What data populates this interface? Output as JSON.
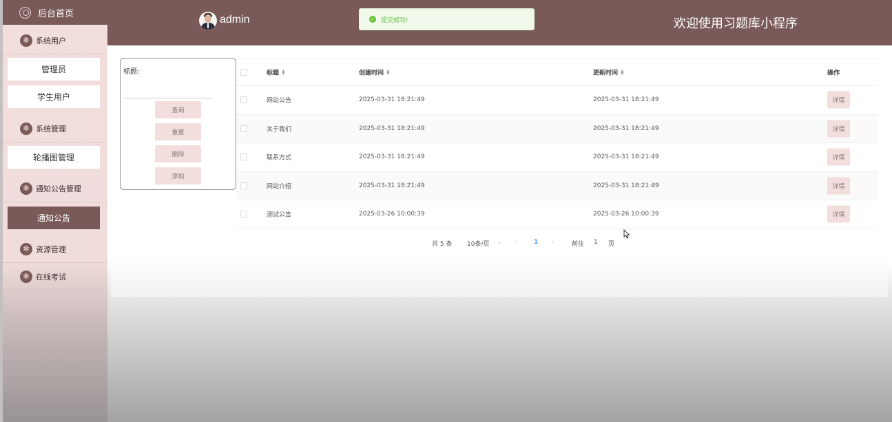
{
  "sidebar": {
    "home_label": "后台首页",
    "groups": {
      "system_users": "系统用户",
      "system_manage": "系统管理",
      "notice_manage": "通知公告管理",
      "resource_manage": "资源管理",
      "online_exam": "在线考试"
    },
    "items": {
      "admin": "管理员",
      "student": "学生用户",
      "carousel": "轮播图管理",
      "notice": "通知公告"
    },
    "active_item": "通知公告"
  },
  "header": {
    "username": "admin",
    "title": "欢迎使用习题库小程序"
  },
  "toast": {
    "message": "提交成功!",
    "icon": "check-circle-icon"
  },
  "search": {
    "label": "标题:",
    "placeholder": "",
    "buttons": {
      "query": "查询",
      "reset": "重置",
      "delete": "删除",
      "add": "添加"
    }
  },
  "table": {
    "columns": {
      "title": "标题",
      "created": "创建时间",
      "updated": "更新时间",
      "ops": "操作"
    },
    "rows": [
      {
        "title": "网站公告",
        "created": "2025-03-31 18:21:49",
        "updated": "2025-03-31 18:21:49",
        "action": "详情"
      },
      {
        "title": "关于我们",
        "created": "2025-03-31 18:21:49",
        "updated": "2025-03-31 18:21:49",
        "action": "详情"
      },
      {
        "title": "联系方式",
        "created": "2025-03-31 18:21:49",
        "updated": "2025-03-31 18:21:49",
        "action": "详情"
      },
      {
        "title": "网站介绍",
        "created": "2025-03-31 18:21:49",
        "updated": "2025-03-31 18:21:49",
        "action": "详情"
      },
      {
        "title": "测试公告",
        "created": "2025-03-26 10:00:39",
        "updated": "2025-03-26 10:00:39",
        "action": "详情"
      }
    ]
  },
  "pagination": {
    "total": "共 5 条",
    "page_size": "10条/页",
    "current_page": "1",
    "goto_label": "前往",
    "goto_value": "1",
    "page_unit": "页"
  },
  "colors": {
    "brand": "#7a5a59",
    "sidebar_bg": "#f1dedd",
    "button_bg": "#f1dedd",
    "success": "#67c23a",
    "pager_active": "#409eff"
  }
}
